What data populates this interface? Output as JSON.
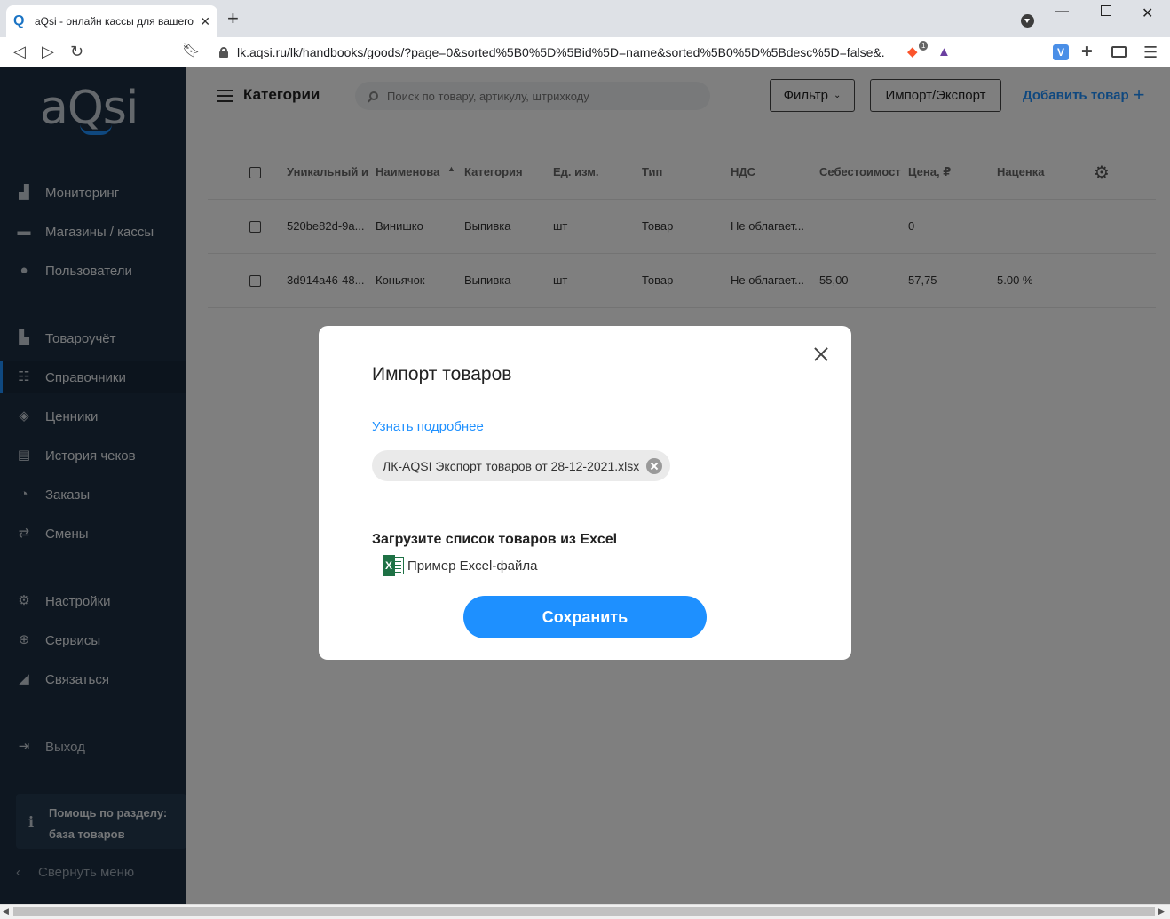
{
  "browser": {
    "tab_title": "aQsi - онлайн кассы для вашего",
    "tab_favicon": "Q",
    "url": "lk.aqsi.ru/lk/handbooks/goods/?page=0&sorted%5B0%5D%5Bid%5D=name&sorted%5B0%5D%5Bdesc%5D=false&...",
    "brave_badge": "1"
  },
  "sidebar": {
    "logo": "aQsi",
    "items": [
      {
        "label": "Мониторинг",
        "icon": "bar-chart-icon"
      },
      {
        "label": "Магазины / кассы",
        "icon": "store-icon"
      },
      {
        "label": "Пользователи",
        "icon": "user-icon"
      },
      {
        "label": "Товароучёт",
        "icon": "boxes-icon"
      },
      {
        "label": "Справочники",
        "icon": "list-icon"
      },
      {
        "label": "Ценники",
        "icon": "price-tag-icon"
      },
      {
        "label": "История чеков",
        "icon": "receipt-icon"
      },
      {
        "label": "Заказы",
        "icon": "clock-icon"
      },
      {
        "label": "Смены",
        "icon": "swap-icon"
      },
      {
        "label": "Настройки",
        "icon": "gear-icon"
      },
      {
        "label": "Сервисы",
        "icon": "plus-circle-icon"
      },
      {
        "label": "Связаться",
        "icon": "megaphone-icon"
      },
      {
        "label": "Выход",
        "icon": "logout-icon"
      }
    ],
    "active_item": "Справочники",
    "help": {
      "line1": "Помощь по разделу:",
      "line2": "база товаров"
    },
    "collapse_label": "Свернуть меню"
  },
  "header": {
    "title": "Категории",
    "search_placeholder": "Поиск по товару, артикулу, штрихкоду",
    "filter_label": "Фильтр",
    "import_export_label": "Импорт/Экспорт",
    "add_label": "Добавить товар"
  },
  "table": {
    "columns": [
      "Уникальный и",
      "Наименова",
      "Категория",
      "Ед. изм.",
      "Тип",
      "НДС",
      "Себестоимост",
      "Цена, ₽",
      "Наценка"
    ],
    "rows": [
      [
        "520be82d-9a...",
        "Винишко",
        "Выпивка",
        "шт",
        "Товар",
        "Не облагает...",
        "",
        "0",
        ""
      ],
      [
        "3d914a46-48...",
        "Коньячок",
        "Выпивка",
        "шт",
        "Товар",
        "Не облагает...",
        "55,00",
        "57,75",
        "5.00 %"
      ]
    ]
  },
  "modal": {
    "title": "Импорт товаров",
    "more_link": "Узнать подробнее",
    "file_name": "ЛК-AQSI Экспорт товаров от 28-12-2021.xlsx",
    "upload_title": "Загрузите список товаров из Excel",
    "example_link": "Пример Excel-файла",
    "save_label": "Сохранить"
  },
  "colors": {
    "accent": "#1e90ff",
    "sidebar_bg": "#1d2f42",
    "excel_green": "#1e7145"
  }
}
